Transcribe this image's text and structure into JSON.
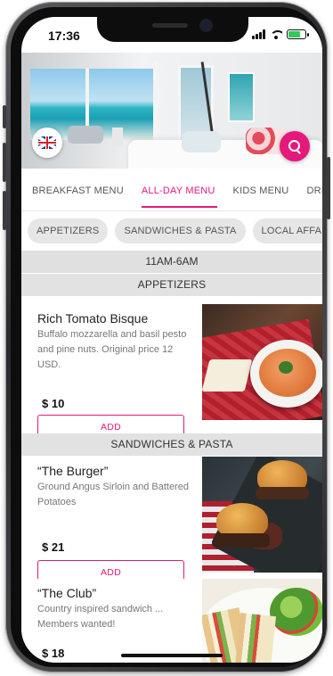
{
  "status": {
    "time": "17:36"
  },
  "hero": {
    "flag_label": "",
    "search_label": ""
  },
  "tabs": [
    {
      "label": "BREAKFAST MENU"
    },
    {
      "label": "ALL-DAY MENU"
    },
    {
      "label": "KIDS MENU"
    },
    {
      "label": "DRINKS"
    }
  ],
  "chips": [
    {
      "label": "APPETIZERS"
    },
    {
      "label": "SANDWICHES & PASTA"
    },
    {
      "label": "LOCAL AFFAIRS"
    }
  ],
  "time_bar": "11AM-6AM",
  "sections": {
    "appetizers": "APPETIZERS",
    "sandwiches": "SANDWICHES & PASTA"
  },
  "items": [
    {
      "name": "Rich Tomato Bisque",
      "description": "Buffalo mozzarella and basil pesto and pine nuts. Original price 12 USD.",
      "price": "$ 10",
      "add_label": "ADD"
    },
    {
      "name": "“The Burger”",
      "description": "Ground Angus Sirloin and Battered Potatoes",
      "price": "$ 21",
      "add_label": "ADD"
    },
    {
      "name": "“The Club”",
      "description": "Country inspired sandwich ... Members wanted!",
      "price": "$ 18"
    }
  ],
  "colors": {
    "accent": "#e4197b",
    "section_bg": "#e2e2e2"
  },
  "icons": {
    "flag": "uk-flag-icon",
    "search": "search-icon"
  }
}
